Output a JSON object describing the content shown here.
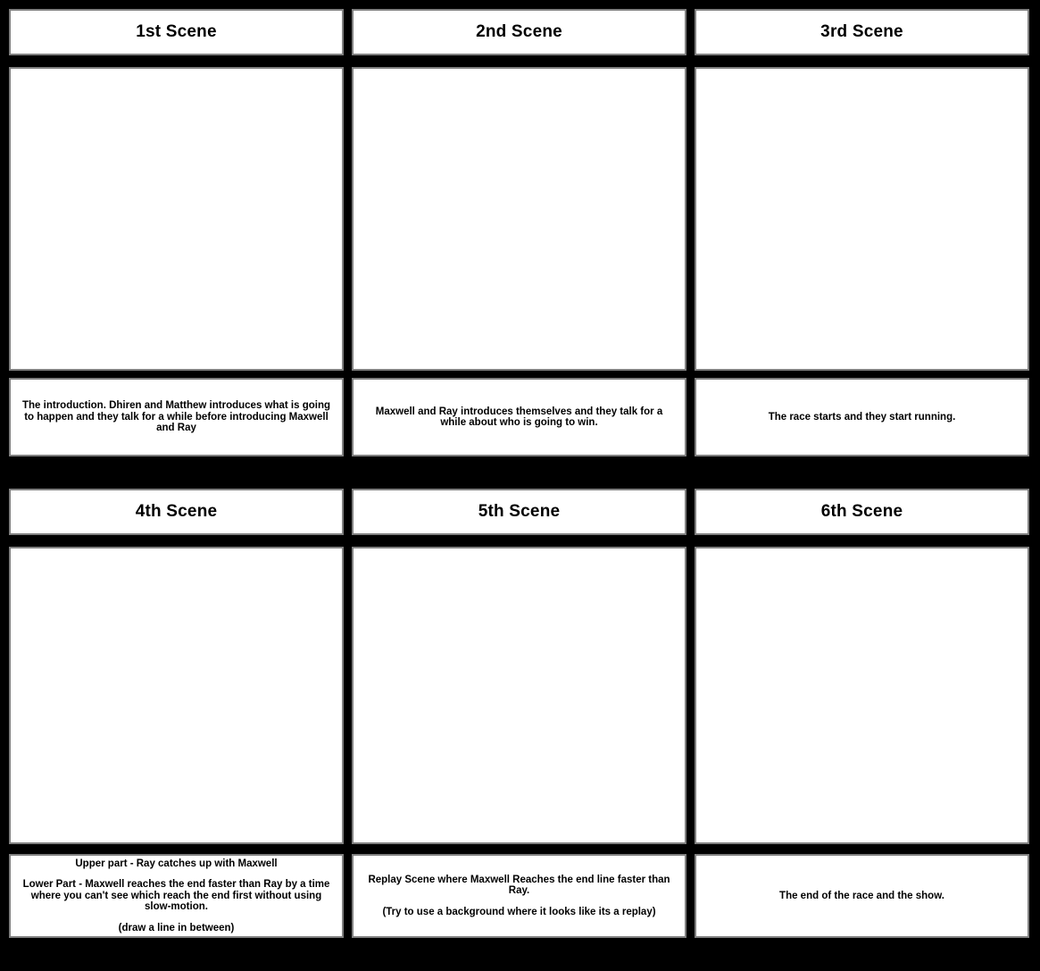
{
  "document": {
    "title": "Storyboard",
    "background_color": "#000000",
    "panel_color": "#ffffff",
    "border_color": "#808080",
    "text_color": "#000000"
  },
  "rows": [
    {
      "scenes": [
        {
          "title": "1st Scene",
          "frame_note": "",
          "caption_lines": [
            "The introduction. Dhiren and Matthew introduces what is going to happen and they talk for a while before introducing Maxwell and Ray"
          ]
        },
        {
          "title": "2nd Scene",
          "frame_note": "",
          "caption_lines": [
            "Maxwell and Ray introduces themselves and they talk for a while about who is going to win."
          ]
        },
        {
          "title": "3rd Scene",
          "frame_note": "",
          "caption_lines": [
            "The race starts and they start running."
          ]
        }
      ]
    },
    {
      "scenes": [
        {
          "title": "4th Scene",
          "frame_note": "",
          "caption_lines": [
            "Upper part - Ray catches up with Maxwell",
            "Lower Part - Maxwell reaches the end faster than Ray by a time where you can't see which reach the end first without using slow-motion.",
            "(draw a line in between)"
          ]
        },
        {
          "title": "5th Scene",
          "frame_note": "",
          "caption_lines": [
            "Replay Scene where Maxwell Reaches the end line faster than Ray.",
            "(Try to use a background where it looks like its a replay)"
          ]
        },
        {
          "title": "6th Scene",
          "frame_note": "",
          "caption_lines": [
            "The end of the race and the show."
          ]
        }
      ]
    }
  ]
}
